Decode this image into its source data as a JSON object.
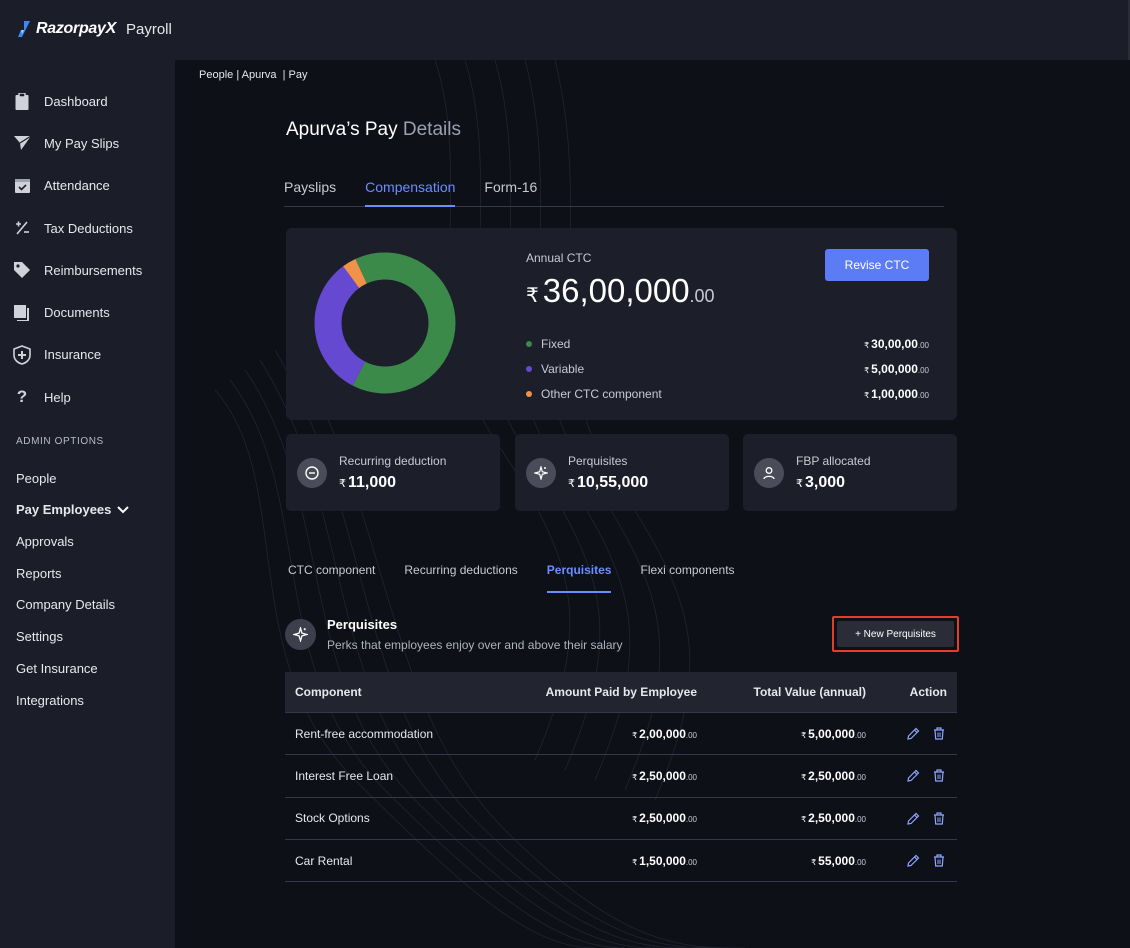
{
  "brand": {
    "name": "RazorpayX",
    "product": "Payroll"
  },
  "sidebar": {
    "items": [
      {
        "label": "Dashboard",
        "icon": "clipboard-icon"
      },
      {
        "label": "My Pay Slips",
        "icon": "paper-plane-icon"
      },
      {
        "label": "Attendance",
        "icon": "calendar-check-icon"
      },
      {
        "label": "Tax Deductions",
        "icon": "percent-icon"
      },
      {
        "label": "Reimbursements",
        "icon": "tag-icon"
      },
      {
        "label": "Documents",
        "icon": "documents-icon"
      },
      {
        "label": "Insurance",
        "icon": "shield-plus-icon"
      },
      {
        "label": "Help",
        "icon": "question-icon"
      }
    ],
    "admin_heading": "ADMIN OPTIONS",
    "admin_items": [
      {
        "label": "People"
      },
      {
        "label": "Pay Employees"
      },
      {
        "label": "Approvals"
      },
      {
        "label": "Reports"
      },
      {
        "label": "Company Details"
      },
      {
        "label": "Settings"
      },
      {
        "label": "Get Insurance"
      },
      {
        "label": "Integrations"
      }
    ]
  },
  "breadcrumb": {
    "a": "People",
    "sep1": "|",
    "b": "Apurva",
    "sep2": "|",
    "c": "Pay"
  },
  "page": {
    "title_main": "Apurva’s Pay",
    "title_light": "Details"
  },
  "tabs": [
    "Payslips",
    "Compensation",
    "Form-16"
  ],
  "active_tab": "Compensation",
  "ctc": {
    "label": "Annual CTC",
    "currency": "₹",
    "amount": "36,00,000",
    "decimals": ".00",
    "revise_label": "Revise CTC",
    "legend": [
      {
        "label": "Fixed",
        "value": "30,00,00",
        "decimals": ".00",
        "color": "#3c8a4a"
      },
      {
        "label": "Variable",
        "value": "5,00,000",
        "decimals": ".00",
        "color": "#6649d1"
      },
      {
        "label": "Other CTC component",
        "value": "1,00,000",
        "decimals": ".00",
        "color": "#f0924a"
      }
    ]
  },
  "stats": [
    {
      "label": "Recurring deduction",
      "currency": "₹",
      "value": "11,000",
      "icon": "minus-circle-icon"
    },
    {
      "label": "Perquisites",
      "currency": "₹",
      "value": "10,55,000",
      "icon": "sparkle-icon"
    },
    {
      "label": "FBP allocated",
      "currency": "₹",
      "value": "3,000",
      "icon": "user-icon"
    }
  ],
  "subtabs": [
    "CTC component",
    "Recurring deductions",
    "Perquisites",
    "Flexi components"
  ],
  "active_subtab": "Perquisites",
  "perquisites": {
    "title": "Perquisites",
    "subtitle": "Perks that employees enjoy over and above their salary",
    "new_label": "+ New Perquisites"
  },
  "table": {
    "headers": [
      "Component",
      "Amount Paid by Employee",
      "Total Value (annual)",
      "Action"
    ],
    "rows": [
      {
        "component": "Rent-free accommodation",
        "paid": "2,00,000",
        "paid_dec": ".00",
        "total": "5,00,000",
        "total_dec": ".00"
      },
      {
        "component": "Interest Free Loan",
        "paid": "2,50,000",
        "paid_dec": ".00",
        "total": "2,50,000",
        "total_dec": ".00"
      },
      {
        "component": "Stock Options",
        "paid": "2,50,000",
        "paid_dec": ".00",
        "total": "2,50,000",
        "total_dec": ".00"
      },
      {
        "component": "Car Rental",
        "paid": "1,50,000",
        "paid_dec": ".00",
        "total": "55,000",
        "total_dec": ".00"
      }
    ]
  },
  "donut": [
    {
      "name": "Fixed",
      "fraction": 0.6
    },
    {
      "name": "Variable",
      "fraction": 0.3
    },
    {
      "name": "Other",
      "fraction": 0.03
    }
  ],
  "colors": {
    "accent": "#6a8eff",
    "button": "#5b7cf4",
    "highlight": "#e0402a",
    "fixed": "#3c8a4a",
    "variable": "#6649d1",
    "other": "#f0924a"
  }
}
